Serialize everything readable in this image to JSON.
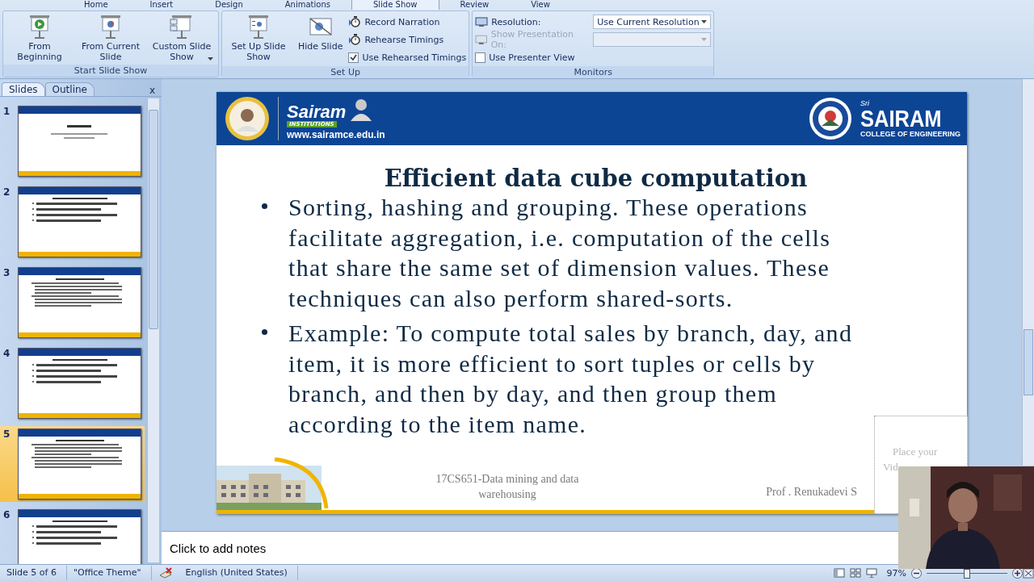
{
  "ribbon": {
    "tabs": [
      {
        "label": "Home",
        "selected": false
      },
      {
        "label": "Insert",
        "selected": false
      },
      {
        "label": "Design",
        "selected": false
      },
      {
        "label": "Animations",
        "selected": false
      },
      {
        "label": "Slide Show",
        "selected": true
      },
      {
        "label": "Review",
        "selected": false
      },
      {
        "label": "View",
        "selected": false
      }
    ],
    "groups": [
      {
        "title": "Start Slide Show",
        "items": [
          {
            "kind": "big",
            "label": "From Beginning"
          },
          {
            "kind": "big",
            "label": "From Current Slide"
          },
          {
            "kind": "big",
            "label": "Custom Slide Show",
            "dropdown": true
          }
        ]
      },
      {
        "title": "Set Up",
        "items": [
          {
            "kind": "big",
            "label": "Set Up Slide Show"
          },
          {
            "kind": "big",
            "label": "Hide Slide"
          },
          {
            "kind": "stack",
            "rows": [
              {
                "kind": "small",
                "label": "Record Narration"
              },
              {
                "kind": "small",
                "label": "Rehearse Timings"
              },
              {
                "kind": "check",
                "label": "Use Rehearsed Timings",
                "checked": true
              }
            ]
          }
        ]
      },
      {
        "title": "Monitors",
        "items": [
          {
            "kind": "monitors",
            "rows": [
              {
                "label": "Resolution:",
                "value": "Use Current Resolution",
                "disabled": false
              },
              {
                "label": "Show Presentation On:",
                "disabled": true
              },
              {
                "label": "Use Presenter View",
                "checked": false,
                "kind": "check"
              }
            ]
          }
        ]
      }
    ]
  },
  "pane": {
    "tabs": [
      {
        "label": "Slides",
        "selected": true
      },
      {
        "label": "Outline",
        "selected": false
      }
    ],
    "close": "x",
    "slides": [
      {
        "number": "1",
        "selected": false,
        "kind": "title"
      },
      {
        "number": "2",
        "selected": false,
        "kind": "list"
      },
      {
        "number": "3",
        "selected": false,
        "kind": "dense"
      },
      {
        "number": "4",
        "selected": false,
        "kind": "list"
      },
      {
        "number": "5",
        "selected": true,
        "kind": "dense"
      },
      {
        "number": "6",
        "selected": false,
        "kind": "list"
      }
    ]
  },
  "slide": {
    "header": {
      "brand": "Sairam",
      "sub": "INSTITUTIONS",
      "url": "www.sairamce.edu.in",
      "sri": "Sri",
      "college": "SAIRAM",
      "college_sub": "COLLEGE OF ENGINEERING"
    },
    "title": "Efficient data cube computation",
    "bullets": [
      "Sorting, hashing and grouping. These operations facilitate aggregation, i.e. computation of the cells that share the same set of dimension values. These techniques can also perform shared-sorts.",
      "Example: To compute total sales by branch, day, and item, it is more efficient to sort tuples or cells by branch, and then by day, and then group them according to the item name."
    ],
    "footer": "17CS651-Data mining and data warehousing",
    "author": "Prof . Renukadevi S",
    "placeholder": [
      "Place your",
      "Vid"
    ]
  },
  "notes": {
    "placeholder": "Click to add notes"
  },
  "status_bar": {
    "slide": "Slide 5 of 6",
    "theme": "\"Office Theme\"",
    "language": "English (United States)",
    "zoom": "97%",
    "zoom_slider": {
      "level": 0.5
    }
  }
}
